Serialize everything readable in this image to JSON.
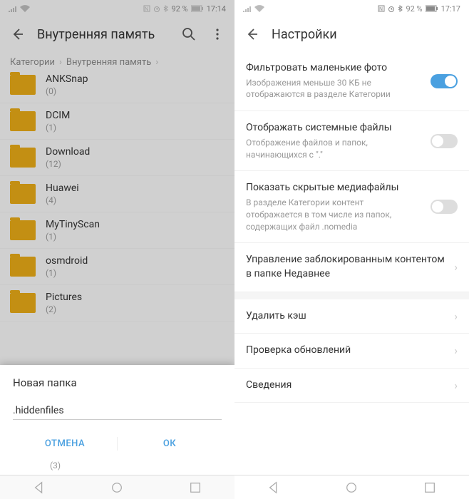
{
  "left": {
    "status": {
      "battery": "92 %",
      "time": "17:14"
    },
    "title": "Внутренняя память",
    "breadcrumb": {
      "root": "Категории",
      "path": "Внутренняя память"
    },
    "folders": [
      {
        "name": "ANKSnap",
        "count": "(0)"
      },
      {
        "name": "DCIM",
        "count": "(1)"
      },
      {
        "name": "Download",
        "count": "(12)"
      },
      {
        "name": "Huawei",
        "count": "(4)"
      },
      {
        "name": "MyTinyScan",
        "count": "(1)"
      },
      {
        "name": "osmdroid",
        "count": "(1)"
      },
      {
        "name": "Pictures",
        "count": "(2)"
      }
    ],
    "leftover": "(3)",
    "dialog": {
      "title": "Новая папка",
      "value": ".hiddenfiles",
      "cancel": "ОТМЕНА",
      "ok": "ОК"
    }
  },
  "right": {
    "status": {
      "battery": "92 %",
      "time": "17:17"
    },
    "title": "Настройки",
    "settings": [
      {
        "title": "Фильтровать маленькие фото",
        "desc": "Изображения меньше 30 КБ не отображаются в разделе Категории",
        "toggle": "on"
      },
      {
        "title": "Отображать системные файлы",
        "desc": "Отображение файлов и папок, начинающихся с \".\"",
        "toggle": "off"
      },
      {
        "title": "Показать скрытые медиафайлы",
        "desc": "В разделе Категории контент отображается в том числе из папок, содержащих файл .nomedia",
        "toggle": "off"
      },
      {
        "title": "Управление заблокированным контентом в папке Недавнее",
        "chevron": true
      }
    ],
    "more": [
      {
        "title": "Удалить кэш"
      },
      {
        "title": "Проверка обновлений"
      },
      {
        "title": "Сведения"
      }
    ]
  }
}
